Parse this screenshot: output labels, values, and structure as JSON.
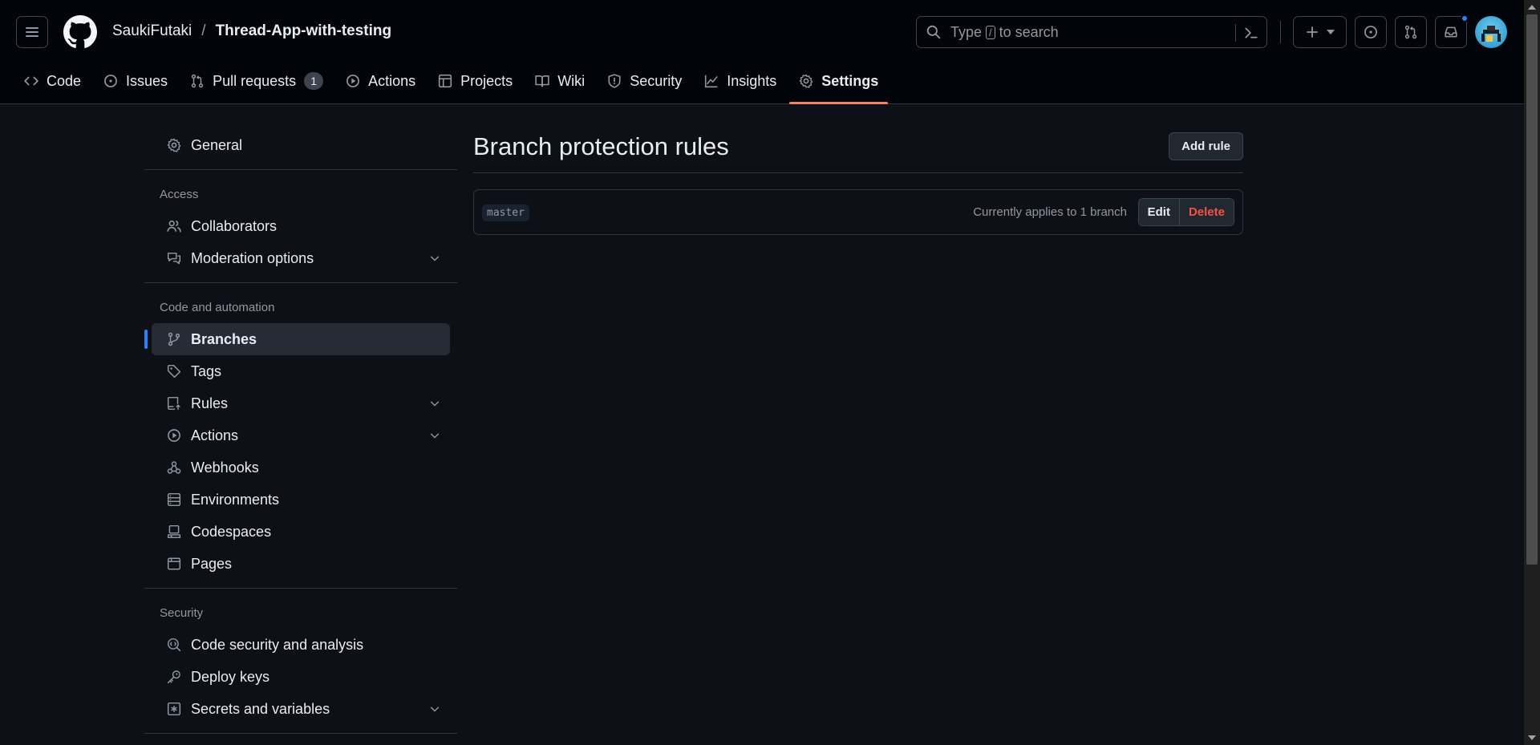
{
  "header": {
    "owner": "SaukiFutaki",
    "separator": "/",
    "repo": "Thread-App-with-testing",
    "search": {
      "before": "Type",
      "key": "/",
      "after": "to search"
    }
  },
  "tabs": [
    {
      "label": "Code",
      "icon": "code-icon"
    },
    {
      "label": "Issues",
      "icon": "issue-opened-icon"
    },
    {
      "label": "Pull requests",
      "icon": "git-pull-request-icon",
      "count": "1"
    },
    {
      "label": "Actions",
      "icon": "play-icon"
    },
    {
      "label": "Projects",
      "icon": "table-icon"
    },
    {
      "label": "Wiki",
      "icon": "book-icon"
    },
    {
      "label": "Security",
      "icon": "shield-icon"
    },
    {
      "label": "Insights",
      "icon": "graph-icon"
    },
    {
      "label": "Settings",
      "icon": "gear-icon",
      "active": true
    }
  ],
  "sidebar": {
    "general": "General",
    "access": {
      "heading": "Access",
      "items": [
        "Collaborators",
        "Moderation options"
      ]
    },
    "code_automation": {
      "heading": "Code and automation",
      "items": [
        "Branches",
        "Tags",
        "Rules",
        "Actions",
        "Webhooks",
        "Environments",
        "Codespaces",
        "Pages"
      ]
    },
    "security": {
      "heading": "Security",
      "items": [
        "Code security and analysis",
        "Deploy keys",
        "Secrets and variables"
      ]
    }
  },
  "main": {
    "title": "Branch protection rules",
    "add_rule": "Add rule",
    "rules": [
      {
        "branch": "master",
        "applies": "Currently applies to 1 branch",
        "edit": "Edit",
        "delete": "Delete"
      }
    ]
  },
  "colors": {
    "background": "#0d1117",
    "header_background": "#010409",
    "active_tab_underline": "#f78166",
    "selected_indicator": "#2f81f7",
    "delete_text": "#f85149"
  }
}
